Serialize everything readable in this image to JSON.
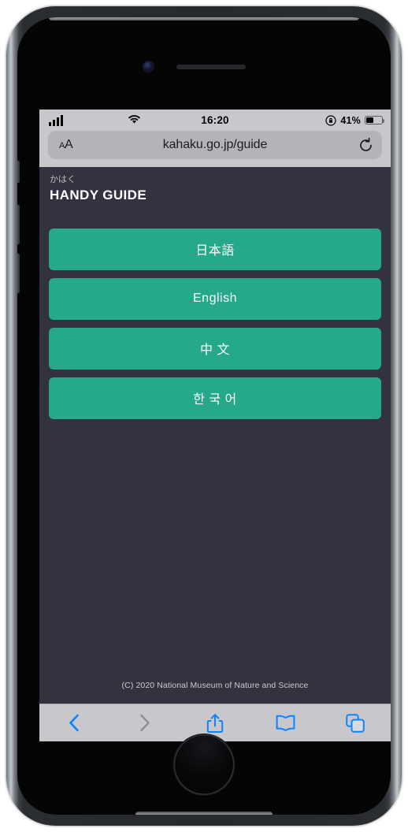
{
  "device": {
    "type": "iphone",
    "frame_color": "#6e7278",
    "camera_icon": "front-camera",
    "speaker_icon": "earpiece-speaker",
    "home_button_label": "Home"
  },
  "status_bar": {
    "signal_icon": "cellular-signal-icon",
    "signal_bars": 4,
    "wifi_icon": "wifi-icon",
    "time": "16:20",
    "rotation_lock_icon": "rotation-lock-icon",
    "battery_percent": "41%",
    "battery_level": 41,
    "battery_icon": "battery-icon",
    "background_color": "#c8c7cc"
  },
  "browser": {
    "name": "Safari",
    "url_bar": {
      "aa_button": {
        "small": "A",
        "large": "A",
        "name": "text-size-button"
      },
      "url": "kahaku.go.jp/guide",
      "placeholder": "Search or enter website name",
      "reload_icon": "reload-icon"
    },
    "toolbar": {
      "items": [
        {
          "name": "back-button",
          "icon": "chevron-left-icon",
          "enabled": true
        },
        {
          "name": "forward-button",
          "icon": "chevron-right-icon",
          "enabled": false
        },
        {
          "name": "share-button",
          "icon": "share-icon",
          "enabled": true
        },
        {
          "name": "bookmarks-button",
          "icon": "book-icon",
          "enabled": true
        },
        {
          "name": "tabs-button",
          "icon": "tabs-icon",
          "enabled": true
        }
      ],
      "active_color": "#0a84ff",
      "disabled_color": "#8e8e93",
      "background_color": "#c8c7cc"
    }
  },
  "page": {
    "background_color": "#33333f",
    "header": {
      "subtitle": "かはく",
      "title": "HANDY GUIDE"
    },
    "languages": {
      "button_color": "#25a98a",
      "text_color": "#ffffff",
      "items": [
        {
          "label": "日本語",
          "name": "language-button-japanese"
        },
        {
          "label": "English",
          "name": "language-button-english"
        },
        {
          "label": "中 文",
          "name": "language-button-chinese"
        },
        {
          "label": "한 국 어",
          "name": "language-button-korean"
        }
      ]
    },
    "footer": {
      "copyright": "(C) 2020 National Museum of Nature and Science"
    }
  }
}
